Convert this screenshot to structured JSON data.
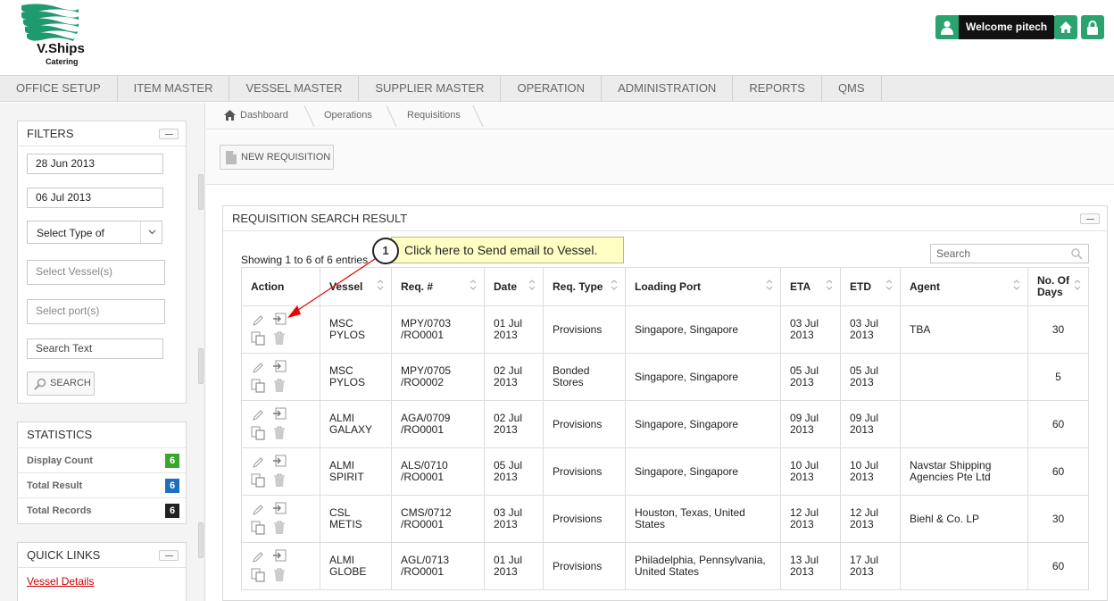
{
  "header": {
    "logo_title": "V.Ships",
    "logo_subtitle": "Catering",
    "welcome": "Welcome pitech"
  },
  "nav": [
    "OFFICE SETUP",
    "ITEM MASTER",
    "VESSEL MASTER",
    "SUPPLIER MASTER",
    "OPERATION",
    "ADMINISTRATION",
    "REPORTS",
    "QMS"
  ],
  "filters": {
    "title": "FILTERS",
    "date_from": "28 Jun 2013",
    "date_to": "06 Jul 2013",
    "type_select": "Select Type of",
    "vessel_ph": "Select Vessel(s)",
    "port_ph": "Select port(s)",
    "text_ph": "Search Text",
    "search_btn": "SEARCH"
  },
  "statistics": {
    "title": "STATISTICS",
    "rows": [
      {
        "label": "Display Count",
        "value": "6",
        "color": "#3aa62e"
      },
      {
        "label": "Total Result",
        "value": "6",
        "color": "#1f6fc1"
      },
      {
        "label": "Total Records",
        "value": "6",
        "color": "#222222"
      }
    ]
  },
  "quick_links": {
    "title": "QUICK LINKS",
    "link": "Vessel Details"
  },
  "breadcrumb": [
    "Dashboard",
    "Operations",
    "Requisitions"
  ],
  "toolbar": {
    "new_req": "NEW REQUISITION"
  },
  "results": {
    "title": "REQUISITION SEARCH RESULT",
    "showing": "Showing 1 to 6 of 6 entries",
    "search_ph": "Search",
    "columns": [
      "Action",
      "Vessel",
      "Req. #",
      "Date",
      "Req. Type",
      "Loading Port",
      "ETA",
      "ETD",
      "Agent",
      "No. Of Days"
    ],
    "rows": [
      [
        "MSC PYLOS",
        "MPY/0703 /RO0001",
        "01 Jul 2013",
        "Provisions",
        "Singapore, Singapore",
        "03 Jul 2013",
        "03 Jul 2013",
        "TBA",
        "30"
      ],
      [
        "MSC PYLOS",
        "MPY/0705 /RO0002",
        "02 Jul 2013",
        "Bonded Stores",
        "Singapore, Singapore",
        "05 Jul 2013",
        "05 Jul 2013",
        "",
        "5"
      ],
      [
        "ALMI GALAXY",
        "AGA/0709 /RO0001",
        "02 Jul 2013",
        "Provisions",
        "Singapore, Singapore",
        "09 Jul 2013",
        "09 Jul 2013",
        "",
        "60"
      ],
      [
        "ALMI SPIRIT",
        "ALS/0710 /RO0001",
        "05 Jul 2013",
        "Provisions",
        "Singapore, Singapore",
        "10 Jul 2013",
        "10 Jul 2013",
        "Navstar Shipping Agencies Pte Ltd",
        "60"
      ],
      [
        "CSL METIS",
        "CMS/0712 /RO0001",
        "03 Jul 2013",
        "Provisions",
        "Houston, Texas, United States",
        "12 Jul 2013",
        "12 Jul 2013",
        "Biehl & Co. LP",
        "30"
      ],
      [
        "ALMI GLOBE",
        "AGL/0713 /RO0001",
        "01 Jul 2013",
        "Provisions",
        "Philadelphia, Pennsylvania, United States",
        "13 Jul 2013",
        "17 Jul 2013",
        "",
        "60"
      ]
    ]
  },
  "callout": {
    "number": "1",
    "text": "Click here to Send email to Vessel."
  }
}
